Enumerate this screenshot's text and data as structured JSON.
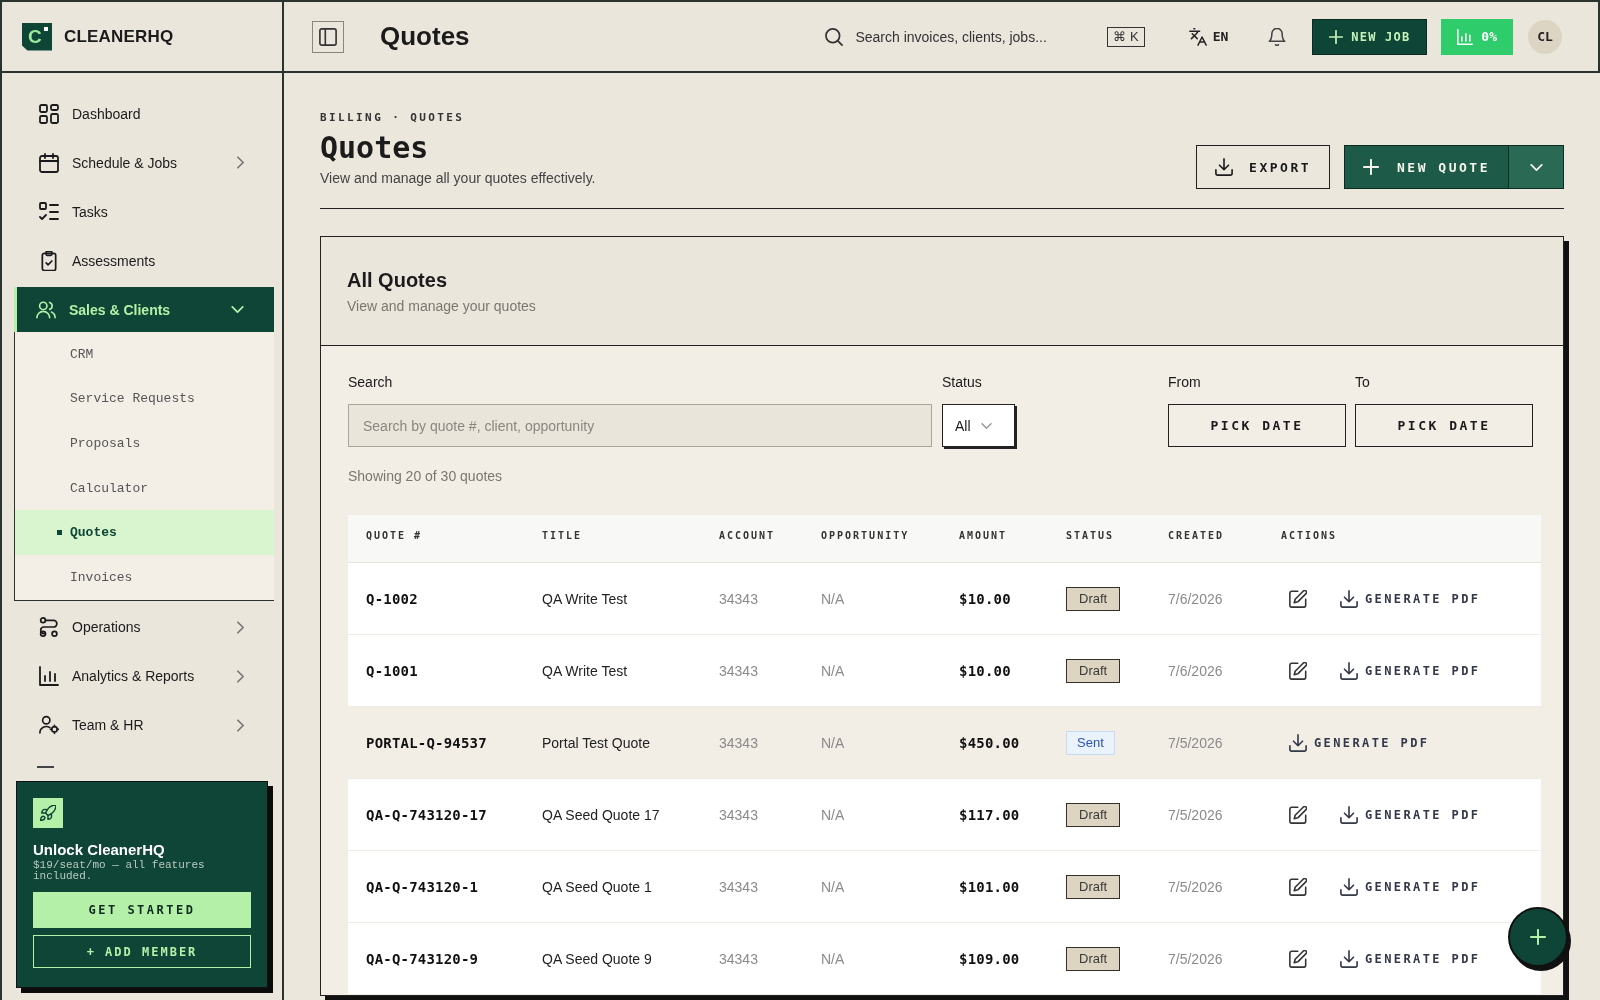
{
  "sidebar": {
    "logo_letter": "C",
    "brand": "CLEANERHQ",
    "nav": [
      {
        "label": "Dashboard",
        "selected": false
      },
      {
        "label": "Schedule & Jobs",
        "selected": false,
        "expanded": false
      },
      {
        "label": "Tasks",
        "selected": false
      },
      {
        "label": "Assessments",
        "selected": false
      },
      {
        "label": "Sales & Clients",
        "selected": true,
        "expanded": true,
        "children": [
          {
            "label": "CRM",
            "selected": false
          },
          {
            "label": "Service Requests",
            "selected": false
          },
          {
            "label": "Proposals",
            "selected": false
          },
          {
            "label": "Calculator",
            "selected": false
          },
          {
            "label": "Quotes",
            "selected": true
          },
          {
            "label": "Invoices",
            "selected": false
          }
        ]
      },
      {
        "label": "Operations",
        "selected": false,
        "expanded": false
      },
      {
        "label": "Analytics & Reports",
        "selected": false,
        "expanded": false
      },
      {
        "label": "Team & HR",
        "selected": false,
        "expanded": false
      }
    ],
    "promo": {
      "title": "Unlock CleanerHQ",
      "text": "$19/seat/mo — all features included.",
      "primary_button": "GET STARTED",
      "secondary_button": "+ ADD MEMBER"
    }
  },
  "topbar": {
    "title": "Quotes",
    "search": {
      "placeholder": "Search invoices, clients, jobs..."
    },
    "shortcut": "⌘ K",
    "language": "EN",
    "new_job_button": "NEW JOB",
    "usage": "0%",
    "avatar": "CL"
  },
  "page": {
    "breadcrumb": "BILLING · QUOTES",
    "title": "Quotes",
    "subtitle": "View and manage all your quotes effectively.",
    "export_button": "EXPORT",
    "new_quote_button": "NEW QUOTE"
  },
  "card": {
    "title": "All Quotes",
    "subtitle": "View and manage your quotes",
    "filters": {
      "search": {
        "label": "Search",
        "placeholder": "Search by quote #, client, opportunity"
      },
      "status": {
        "label": "Status",
        "value": "All"
      },
      "from": {
        "label": "From",
        "button": "PICK DATE"
      },
      "to": {
        "label": "To",
        "button": "PICK DATE"
      }
    },
    "summary": "Showing 20 of 30 quotes",
    "table": {
      "columns": [
        "QUOTE #",
        "TITLE",
        "ACCOUNT",
        "OPPORTUNITY",
        "AMOUNT",
        "STATUS",
        "CREATED",
        "ACTIONS"
      ],
      "rows": [
        {
          "quote": "Q-1002",
          "title": "QA Write Test",
          "account": "34343",
          "opportunity": "N/A",
          "amount": "$10.00",
          "status": {
            "label": "Draft",
            "kind": "draft"
          },
          "created": "7/6/2026",
          "editable": true,
          "action": "GENERATE PDF",
          "highlighted": false
        },
        {
          "quote": "Q-1001",
          "title": "QA Write Test",
          "account": "34343",
          "opportunity": "N/A",
          "amount": "$10.00",
          "status": {
            "label": "Draft",
            "kind": "draft"
          },
          "created": "7/6/2026",
          "editable": true,
          "action": "GENERATE PDF",
          "highlighted": false
        },
        {
          "quote": "PORTAL-Q-94537",
          "title": "Portal Test Quote",
          "account": "34343",
          "opportunity": "N/A",
          "amount": "$450.00",
          "status": {
            "label": "Sent",
            "kind": "sent"
          },
          "created": "7/5/2026",
          "editable": false,
          "action": "GENERATE PDF",
          "highlighted": true
        },
        {
          "quote": "QA-Q-743120-17",
          "title": "QA Seed Quote 17",
          "account": "34343",
          "opportunity": "N/A",
          "amount": "$117.00",
          "status": {
            "label": "Draft",
            "kind": "draft"
          },
          "created": "7/5/2026",
          "editable": true,
          "action": "GENERATE PDF",
          "highlighted": false
        },
        {
          "quote": "QA-Q-743120-1",
          "title": "QA Seed Quote 1",
          "account": "34343",
          "opportunity": "N/A",
          "amount": "$101.00",
          "status": {
            "label": "Draft",
            "kind": "draft"
          },
          "created": "7/5/2026",
          "editable": true,
          "action": "GENERATE PDF",
          "highlighted": false
        },
        {
          "quote": "QA-Q-743120-9",
          "title": "QA Seed Quote 9",
          "account": "34343",
          "opportunity": "N/A",
          "amount": "$109.00",
          "status": {
            "label": "Draft",
            "kind": "draft"
          },
          "created": "7/5/2026",
          "editable": true,
          "action": "GENERATE PDF",
          "highlighted": false
        }
      ]
    }
  }
}
